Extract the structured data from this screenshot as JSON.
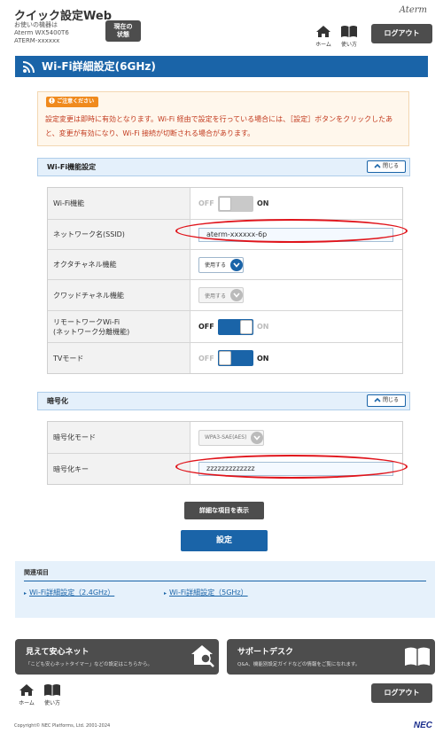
{
  "header": {
    "app_title": "クイック設定Web",
    "device_label": "お使いの機器は",
    "device_model": "Aterm WX5400T6",
    "device_name": "ATERM-xxxxxx",
    "status_button": "現在の\n状態",
    "brand": "Aterm",
    "home_label": "ホーム",
    "manual_label": "使い方",
    "logout_label": "ログアウト"
  },
  "page": {
    "title": "Wi-Fi詳細設定(6GHz)"
  },
  "caution": {
    "badge": "ご注意ください",
    "text": "設定変更は即時に有効となります。Wi-Fi 経由で設定を行っている場合には、［設定］ボタンをクリックしたあと、変更が有効になり、Wi-Fi 接続が切断される場合があります。"
  },
  "wifi_section": {
    "title": "Wi-Fi機能設定",
    "close_label": "閉じる",
    "rows": [
      {
        "label": "Wi-Fi機能",
        "type": "toggle",
        "off": "OFF",
        "on": "ON",
        "state": "on",
        "enabled": false
      },
      {
        "label": "ネットワーク名(SSID)",
        "type": "text",
        "value": "aterm-xxxxxx-6p"
      },
      {
        "label": "オクタチャネル機能",
        "type": "select",
        "value": "使用する",
        "enabled": true
      },
      {
        "label": "クワッドチャネル機能",
        "type": "select",
        "value": "使用する",
        "enabled": false
      },
      {
        "label": "リモートワークWi-Fi\n(ネットワーク分離機能)",
        "type": "toggle",
        "off": "OFF",
        "on": "ON",
        "state": "off",
        "enabled": true
      },
      {
        "label": "TVモード",
        "type": "toggle",
        "off": "OFF",
        "on": "ON",
        "state": "on",
        "enabled": true
      }
    ]
  },
  "encryption_section": {
    "title": "暗号化",
    "close_label": "閉じる",
    "rows": [
      {
        "label": "暗号化モード",
        "type": "select",
        "value": "WPA3-SAE(AES)",
        "enabled": false
      },
      {
        "label": "暗号化キー",
        "type": "text",
        "value": "zzzzzzzzzzzzz"
      }
    ]
  },
  "buttons": {
    "show_details": "詳細な項目を表示",
    "apply": "設定"
  },
  "related": {
    "title": "関連項目",
    "links": [
      "Wi-Fi詳細設定（2.4GHz）",
      "Wi-Fi詳細設定（5GHz）"
    ]
  },
  "banners": [
    {
      "title": "見えて安心ネット",
      "subtitle": "「こども安心ネットタイマー」などの設定はこちらから。"
    },
    {
      "title": "サポートデスク",
      "subtitle": "Q&A、機能別設定ガイドなどの情報をご覧になれます。"
    }
  ],
  "footer": {
    "home_label": "ホーム",
    "manual_label": "使い方",
    "logout_label": "ログアウト",
    "copyright": "Copyright© NEC Platforms, Ltd. 2001-2024",
    "brand": "NEC"
  },
  "colors": {
    "primary": "#1a64a8",
    "dark_button": "#4d4d4d",
    "caution_text": "#c23a1e",
    "caution_badge": "#f08a1d",
    "highlight": "#e0141b"
  }
}
